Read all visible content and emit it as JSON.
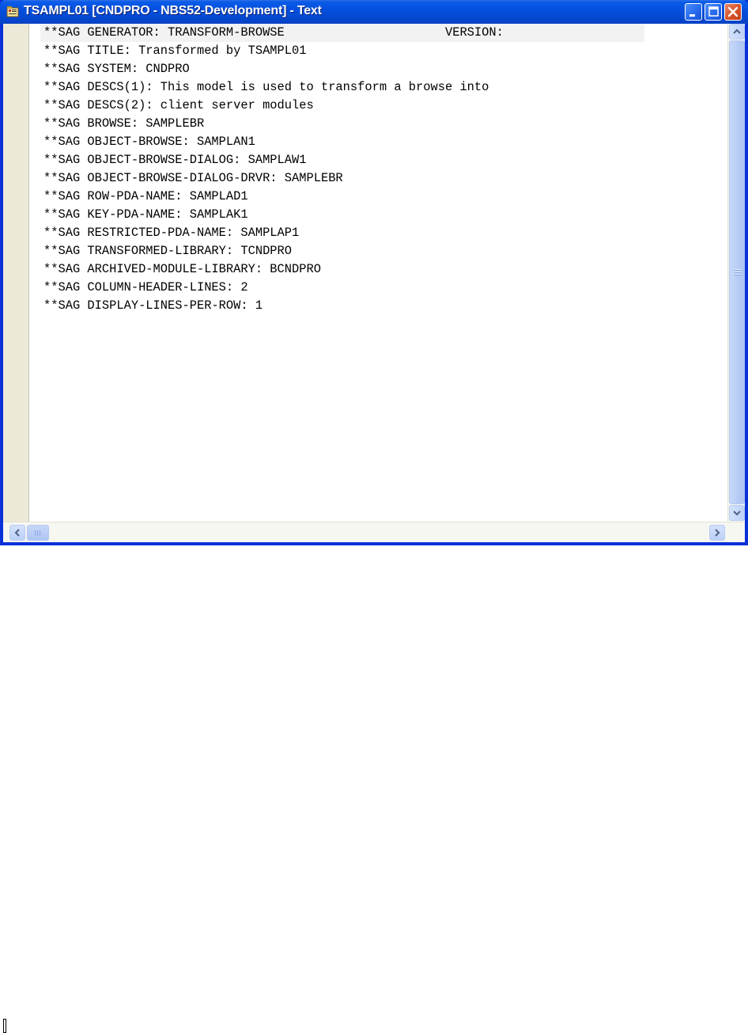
{
  "window": {
    "title": "TSAMPL01 [CNDPRO - NBS52-Development] - Text",
    "minimize_icon": "minimize-icon",
    "maximize_icon": "maximize-icon",
    "close_icon": "close-icon"
  },
  "editor": {
    "lines": [
      "**SAG GENERATOR: TRANSFORM-BROWSE                      VERSION:",
      "**SAG TITLE: Transformed by TSAMPL01",
      "**SAG SYSTEM: CNDPRO",
      "**SAG DESCS(1): This model is used to transform a browse into",
      "**SAG DESCS(2): client server modules",
      "**SAG BROWSE: SAMPLEBR",
      "**SAG OBJECT-BROWSE: SAMPLAN1",
      "**SAG OBJECT-BROWSE-DIALOG: SAMPLAW1",
      "**SAG OBJECT-BROWSE-DIALOG-DRVR: SAMPLEBR",
      "**SAG ROW-PDA-NAME: SAMPLAD1",
      "**SAG KEY-PDA-NAME: SAMPLAK1",
      "**SAG RESTRICTED-PDA-NAME: SAMPLAP1",
      "**SAG TRANSFORMED-LIBRARY: TCNDPRO",
      "**SAG ARCHIVED-MODULE-LIBRARY: BCNDPRO",
      "**SAG COLUMN-HEADER-LINES: 2",
      "**SAG DISPLAY-LINES-PER-ROW: 1"
    ],
    "current_line_index": 0
  },
  "colors": {
    "titlebar": "#0550df",
    "frame": "#0831d9",
    "current_line": "#f2f2f2",
    "gutter": "#ece9d8"
  }
}
